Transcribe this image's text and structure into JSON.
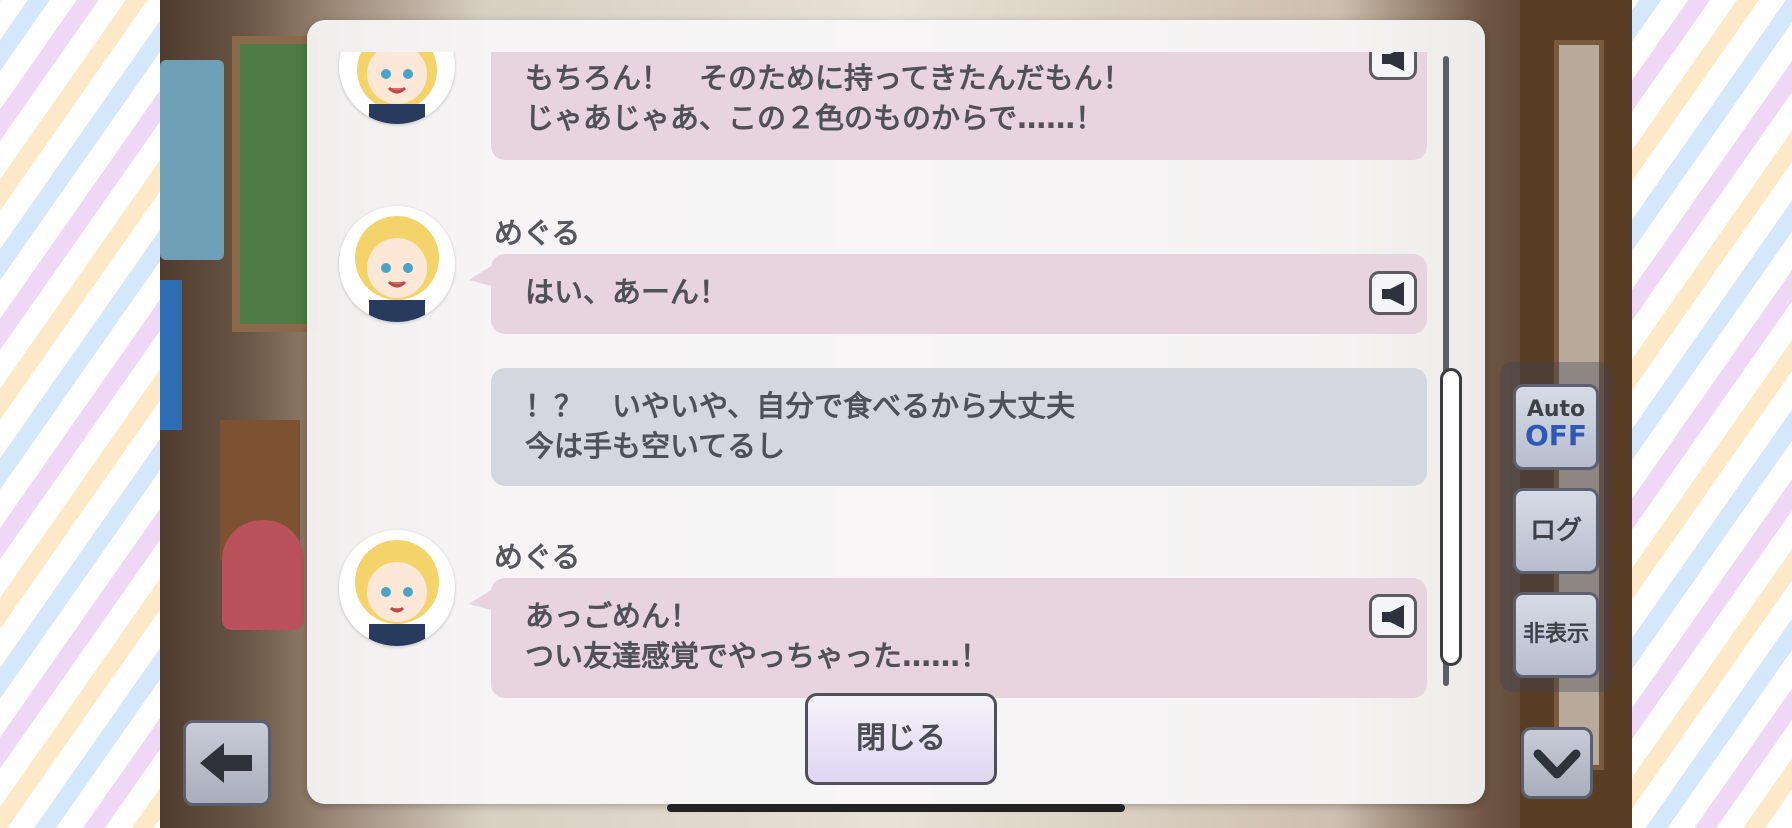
{
  "log": {
    "entries": [
      {
        "type": "character",
        "speaker": "",
        "lines": [
          "もちろん！　そのために持ってきたんだもん！",
          "じゃあじゃあ、この２色のものからで……！"
        ],
        "voice_icon": "speaker-icon"
      },
      {
        "type": "character",
        "speaker": "めぐる",
        "lines": [
          "はい、あーん！"
        ],
        "voice_icon": "speaker-icon"
      },
      {
        "type": "player",
        "lines": [
          "！？　いやいや、自分で食べるから大丈夫",
          "今は手も空いてるし"
        ]
      },
      {
        "type": "character",
        "speaker": "めぐる",
        "lines": [
          "あっごめん！",
          "つい友達感覚でやっちゃった……！"
        ],
        "voice_icon": "speaker-icon"
      }
    ],
    "close_label": "閉じる"
  },
  "controls": {
    "auto_label": "Auto",
    "auto_state": "OFF",
    "log_label": "ログ",
    "hide_label": "非表示"
  },
  "colors": {
    "character_bubble": "#e8d4df",
    "player_bubble": "#d4d7de",
    "auto_off": "#2f57b8"
  }
}
